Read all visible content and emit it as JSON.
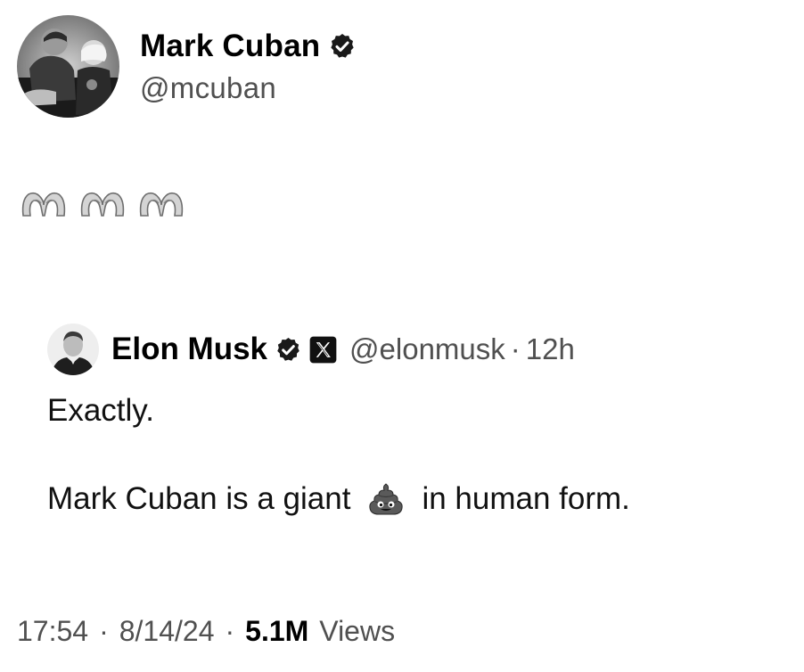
{
  "author": {
    "name": "Mark Cuban",
    "handle": "@mcuban",
    "verified": true
  },
  "post": {
    "reaction_emoji": [
      "heart-hands",
      "heart-hands",
      "heart-hands"
    ]
  },
  "quoted": {
    "name": "Elon Musk",
    "handle": "@elonmusk",
    "separator": "·",
    "time": "12h",
    "verified": true,
    "affiliation_badge": "x-logo",
    "line1": "Exactly.",
    "line2_before": "Mark Cuban is a giant",
    "line2_emoji": "pile-of-poo",
    "line2_after": "in human form."
  },
  "meta": {
    "time": "17:54",
    "sep1": "·",
    "date": "8/14/24",
    "sep2": "·",
    "views_count": "5.1M",
    "views_label": "Views"
  }
}
